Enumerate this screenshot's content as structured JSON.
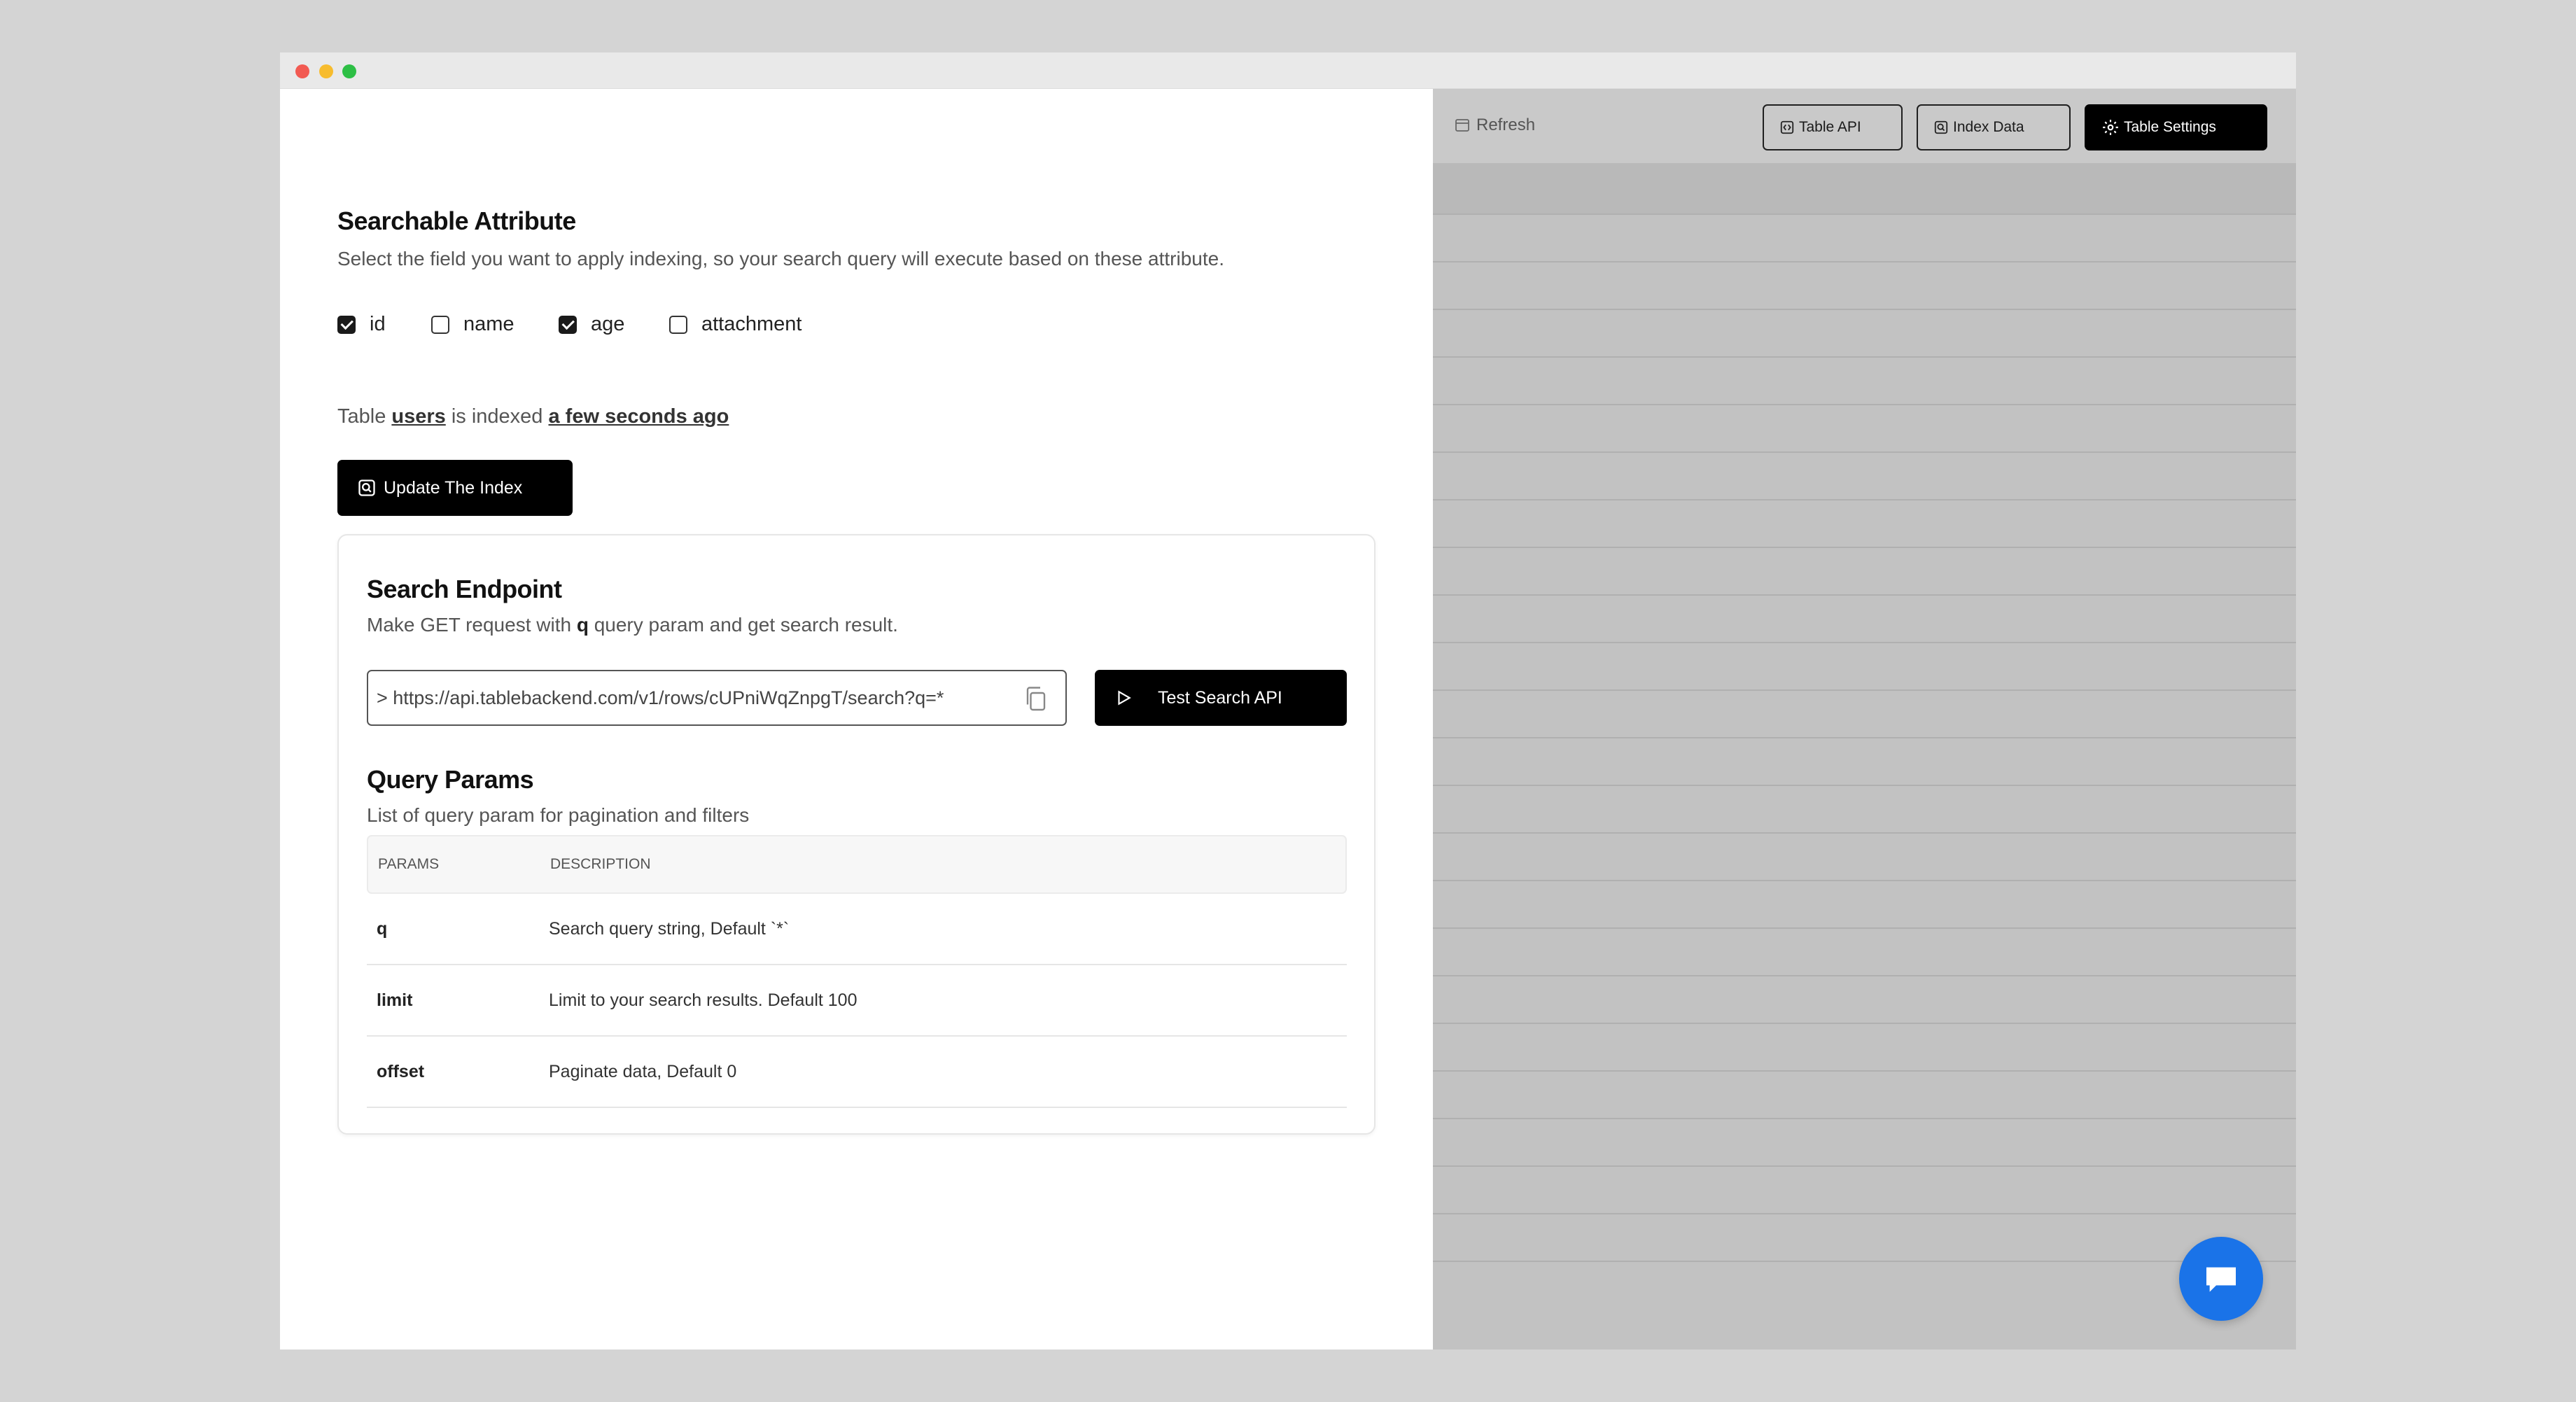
{
  "searchable": {
    "title": "Searchable Attribute",
    "description": "Select the field you want to apply indexing, so your search query will execute based on these attribute.",
    "fields": [
      {
        "label": "id",
        "checked": true
      },
      {
        "label": "name",
        "checked": false
      },
      {
        "label": "age",
        "checked": true
      },
      {
        "label": "attachment",
        "checked": false
      }
    ]
  },
  "index_status": {
    "prefix": "Table",
    "table_name": "users",
    "middle": "is indexed",
    "time": "a few seconds ago"
  },
  "update_button": {
    "label": "Update The Index",
    "icon": "search-square-icon"
  },
  "endpoint_card": {
    "title": "Search Endpoint",
    "desc_prefix": "Make GET request with",
    "desc_param": "q",
    "desc_suffix": "query param and get search result.",
    "url": "> https://api.tablebackend.com/v1/rows/cUPniWqZnpgT/search?q=*",
    "test_button": "Test Search API"
  },
  "query_params": {
    "title": "Query Params",
    "description": "List of query param for pagination and filters",
    "headers": [
      "PARAMS",
      "DESCRIPTION"
    ],
    "rows": [
      {
        "param": "q",
        "description": "Search query string, Default `*`"
      },
      {
        "param": "limit",
        "description": "Limit to your search results. Default 100"
      },
      {
        "param": "offset",
        "description": "Paginate data, Default 0"
      }
    ]
  },
  "toolbar": {
    "refresh": "Refresh",
    "table_api": "Table API",
    "index_data": "Index Data",
    "table_settings": "Table Settings"
  },
  "colors": {
    "accent": "#1a73e8",
    "dark": "#000000"
  }
}
